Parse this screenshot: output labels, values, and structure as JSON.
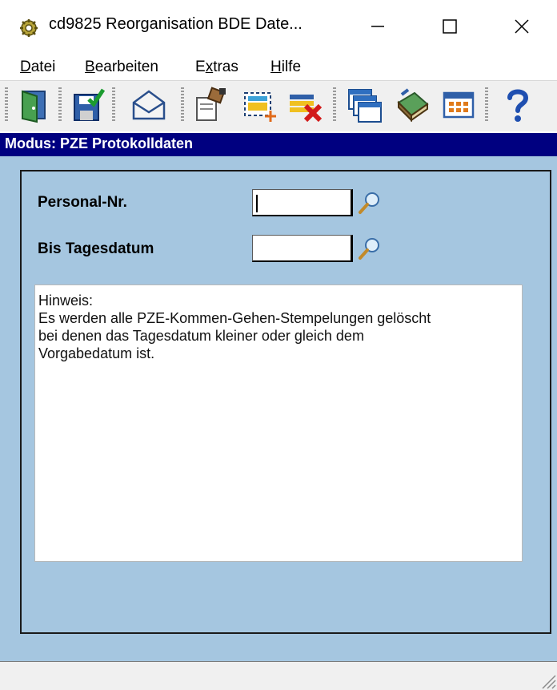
{
  "window": {
    "title": "cd9825 Reorganisation BDE Date...",
    "app_icon": "gear-icon"
  },
  "menu": {
    "items": [
      {
        "label_u": "D",
        "label_rest": "atei"
      },
      {
        "label_u": "B",
        "label_rest": "earbeiten"
      },
      {
        "label_pre": "E",
        "label_u": "x",
        "label_rest": "tras"
      },
      {
        "label_u": "H",
        "label_rest": "ilfe"
      }
    ]
  },
  "toolbar": {
    "buttons": [
      "exit-door-icon",
      "save-icon",
      "mail-icon",
      "edit-notepad-icon",
      "new-record-icon",
      "delete-record-icon",
      "windows-icon",
      "book-icon",
      "calendar-icon",
      "help-icon"
    ]
  },
  "mode": {
    "label": "Modus: PZE Protokolldaten"
  },
  "form": {
    "personal_label": "Personal-Nr.",
    "personal_value": "",
    "date_label": "Bis Tagesdatum",
    "date_value": ""
  },
  "hint": {
    "lines": [
      "Hinweis:",
      "Es werden alle PZE-Kommen-Gehen-Stempelungen gelöscht",
      "bei denen das Tagesdatum kleiner oder gleich dem",
      "Vorgabedatum ist."
    ]
  },
  "colors": {
    "mode_bar": "#000080",
    "content_bg": "#a5c6e0",
    "toolbar_bg": "#f0f0f0"
  }
}
